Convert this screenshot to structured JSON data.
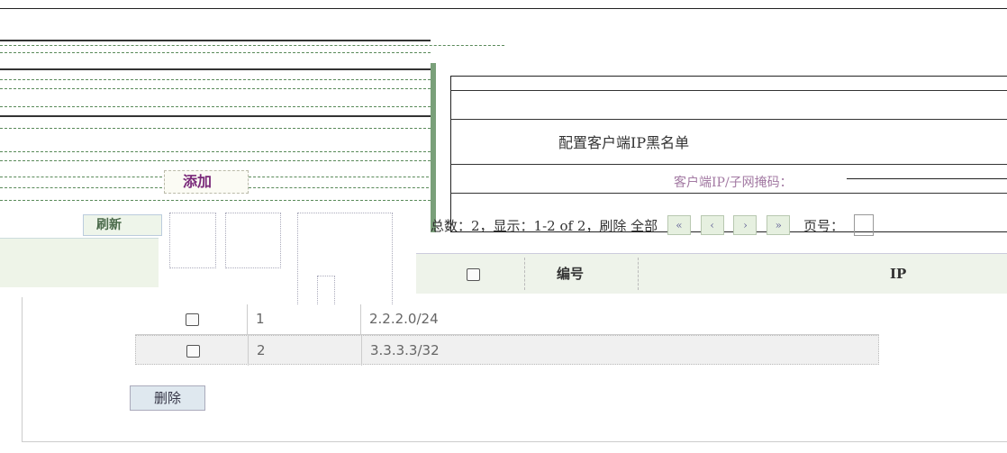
{
  "left_panel": {
    "add_button": "添加",
    "label": "",
    "button": "刷新"
  },
  "dialog": {
    "title": "",
    "heading": "配置客户端IP黑名单",
    "field_label": "客户端IP/子网掩码："
  },
  "pager": {
    "summary": "总数：2，显示：1-2 of 2，刷除 全部",
    "buttons": [
      "«",
      "‹",
      "›",
      "»"
    ],
    "page_label": "页号："
  },
  "table": {
    "headers": {
      "checkbox": "",
      "number": "编号",
      "ip": "IP"
    },
    "rows": [
      {
        "number": "1",
        "ip": "2.2.2.0/24"
      },
      {
        "number": "2",
        "ip": "3.3.3.3/32"
      }
    ]
  },
  "delete_button": "删除",
  "colors": {
    "dialog_border": "#7aa07a",
    "header_bg": "#eef3ea",
    "delete_btn_bg": "#dfe8ef"
  }
}
